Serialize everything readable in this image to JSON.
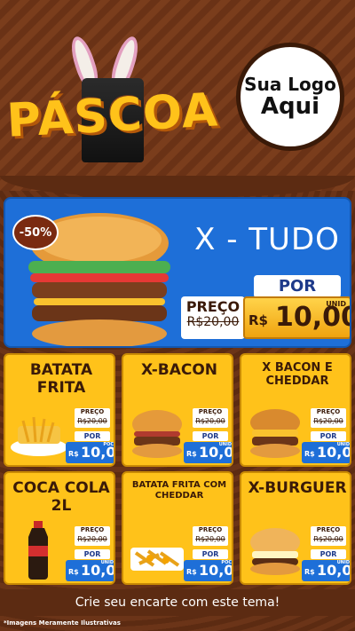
{
  "header": {
    "title": "PÁSCOA",
    "logo_line1": "Sua Logo",
    "logo_line2": "Aqui"
  },
  "featured": {
    "badge": "-50%",
    "name": "X - TUDO",
    "preco_label": "PREÇO",
    "old_price": "R$20,00",
    "por_label": "POR",
    "currency": "R$",
    "price": "10,00",
    "unit": "UNID"
  },
  "products": [
    {
      "name": "BATATA FRITA",
      "preco_label": "PREÇO",
      "old_price": "R$20,00",
      "por_label": "POR",
      "currency": "R$",
      "price": "10,00",
      "unit": "POC"
    },
    {
      "name": "X-BACON",
      "preco_label": "PREÇO",
      "old_price": "R$20,00",
      "por_label": "POR",
      "currency": "R$",
      "price": "10,00",
      "unit": "UNID"
    },
    {
      "name": "X BACON E CHEDDAR",
      "preco_label": "PREÇO",
      "old_price": "R$20,00",
      "por_label": "POR",
      "currency": "R$",
      "price": "10,00",
      "unit": "UNID"
    },
    {
      "name": "COCA COLA 2L",
      "preco_label": "PREÇO",
      "old_price": "R$20,00",
      "por_label": "POR",
      "currency": "R$",
      "price": "10,00",
      "unit": "UNID"
    },
    {
      "name": "BATATA FRITA COM CHEDDAR",
      "preco_label": "PREÇO",
      "old_price": "R$20,00",
      "por_label": "POR",
      "currency": "R$",
      "price": "10,00",
      "unit": "POC"
    },
    {
      "name": "X-BURGUER",
      "preco_label": "PREÇO",
      "old_price": "R$20,00",
      "por_label": "POR",
      "currency": "R$",
      "price": "10,00",
      "unit": "UNID"
    }
  ],
  "footer": {
    "cta": "Crie seu encarte com este tema!",
    "note": "*Imagens Meramente Ilustrativas"
  },
  "colors": {
    "chocolate": "#5c2b12",
    "yellow": "#ffc21a",
    "blue": "#1e6fd8"
  }
}
